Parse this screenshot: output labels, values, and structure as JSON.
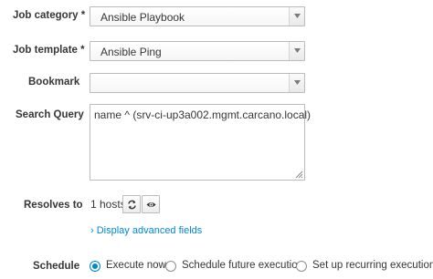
{
  "form": {
    "job_category": {
      "label": "Job category *",
      "value": "Ansible Playbook"
    },
    "job_template": {
      "label": "Job template *",
      "value": "Ansible Ping"
    },
    "bookmark": {
      "label": "Bookmark",
      "value": ""
    },
    "search_query": {
      "label": "Search Query",
      "value": "name ^ (srv-ci-up3a002.mgmt.carcano.local)"
    },
    "resolves_to": {
      "label": "Resolves to",
      "hosts_text": "1 hosts",
      "buttons": [
        "refresh-icon",
        "eye-icon"
      ]
    },
    "advanced_link": "› Display advanced fields",
    "schedule": {
      "label": "Schedule",
      "options": [
        {
          "label": "Execute now",
          "checked": true
        },
        {
          "label": "Schedule future execution",
          "checked": false
        },
        {
          "label": "Set up recurring execution",
          "checked": false
        }
      ]
    }
  },
  "colors": {
    "accent": "#0088ce",
    "text": "#363636",
    "border": "#bbbbbb"
  }
}
